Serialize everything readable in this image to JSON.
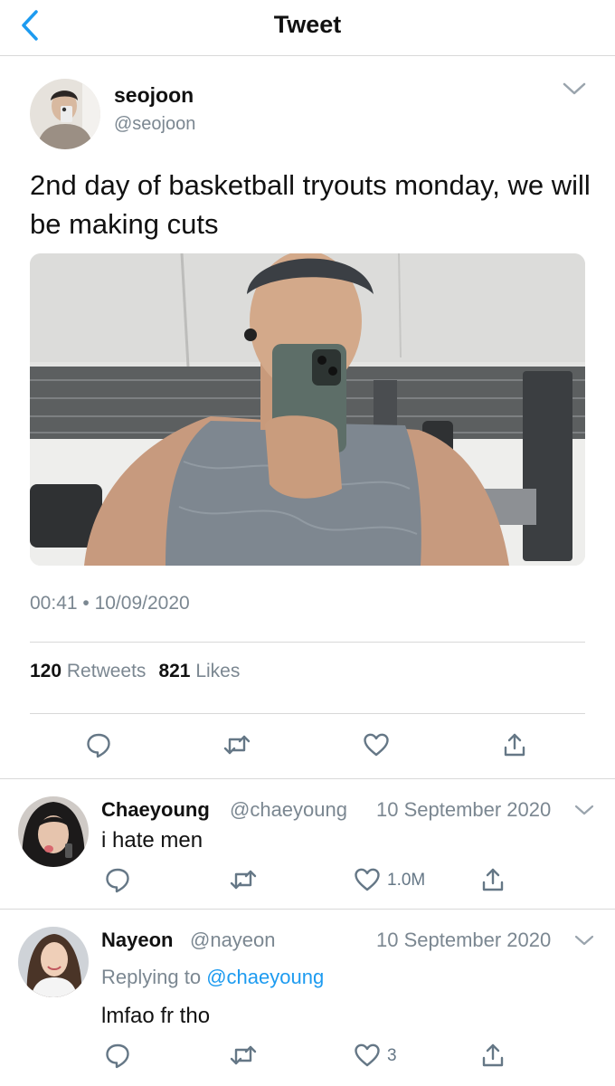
{
  "header": {
    "title": "Tweet",
    "back_icon": "chevron-left-icon"
  },
  "tweet": {
    "name": "seojoon",
    "handle": "@seojoon",
    "text": "2nd day of basketball tryouts monday, we will be making cuts",
    "timestamp": "00:41 • 10/09/2020",
    "retweets_count": "120",
    "retweets_label": "Retweets",
    "likes_count": "821",
    "likes_label": "Likes"
  },
  "replies": [
    {
      "name": "Chaeyoung",
      "handle": "@chaeyoung",
      "date": "10 September 2020",
      "text": "i hate men",
      "likes": "1.0M"
    },
    {
      "name": "Nayeon",
      "handle": "@nayeon",
      "date": "10 September 2020",
      "replying_prefix": "Replying to",
      "replying_to": "@chaeyoung",
      "text": "lmfao fr tho",
      "likes": "3"
    }
  ],
  "colors": {
    "accent": "#1d9bf0",
    "secondary_text": "#7b8791",
    "divider": "#d8d8d8"
  }
}
